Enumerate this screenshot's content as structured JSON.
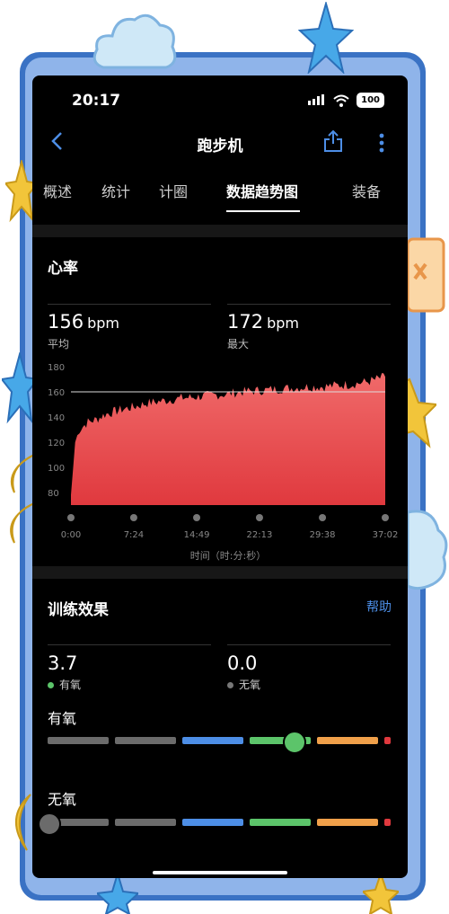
{
  "status_bar": {
    "time": "20:17",
    "battery": "100"
  },
  "nav": {
    "title": "跑步机"
  },
  "tabs": [
    "概述",
    "统计",
    "计圈",
    "数据趋势图",
    "装备"
  ],
  "heart_rate": {
    "title": "心率",
    "avg_value": "156",
    "avg_unit": "bpm",
    "avg_label": "平均",
    "max_value": "172",
    "max_unit": "bpm",
    "max_label": "最大"
  },
  "chart_data": {
    "type": "area",
    "color": "#e0393e",
    "yticks": [
      "180",
      "160",
      "140",
      "120",
      "100",
      "80"
    ],
    "ylim": [
      70,
      180
    ],
    "reference_line": 160,
    "xticks": [
      "0:00",
      "7:24",
      "14:49",
      "22:13",
      "29:38",
      "37:02"
    ],
    "xlabel": "时间（时:分:秒）",
    "series": [
      {
        "x": [
          "0:00",
          "0:30",
          "1:00",
          "2:00",
          "3:00",
          "4:00",
          "5:00",
          "6:00",
          "7:24",
          "9:00",
          "11:00",
          "13:00",
          "14:49",
          "16:00",
          "18:00",
          "20:00",
          "22:13",
          "24:00",
          "26:00",
          "28:00",
          "29:38",
          "31:00",
          "33:00",
          "35:00",
          "37:02"
        ],
        "values": [
          78,
          120,
          130,
          136,
          138,
          142,
          144,
          146,
          148,
          151,
          153,
          155,
          156,
          157,
          158,
          160,
          161,
          162,
          163,
          164,
          164,
          165,
          166,
          168,
          172
        ]
      }
    ]
  },
  "training_effect": {
    "title": "训练效果",
    "help": "帮助",
    "aerobic_value": "3.7",
    "aerobic_label": "有氧",
    "anaerobic_value": "0.0",
    "anaerobic_label": "无氧",
    "aerobic_scale_label": "有氧",
    "anaerobic_scale_label": "无氧",
    "aerobic_level": 3.7,
    "anaerobic_level": 0.0,
    "aerobic_dot_color": "#5cc46a",
    "anaerobic_dot_color": "#777777"
  },
  "scale_colors": [
    "#6b6b6b",
    "#6b6b6b",
    "#4d8ee6",
    "#5cc46a",
    "#f0a04a",
    "#e0393e"
  ]
}
